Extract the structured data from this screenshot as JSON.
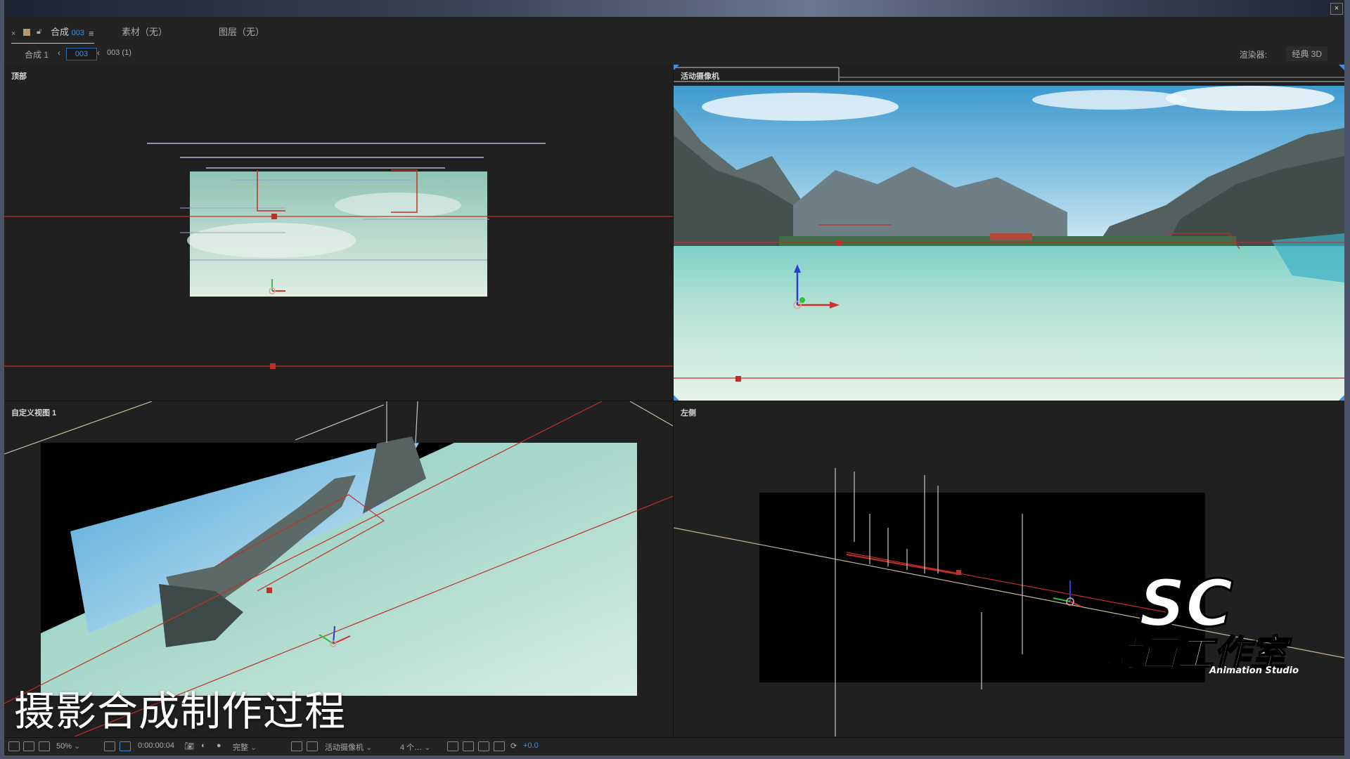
{
  "window": {
    "close_label": "×"
  },
  "tabs": {
    "close": "×",
    "comp_label": "合成",
    "comp_number": "003",
    "menu": "≡",
    "footage": "素材（无）",
    "layer": "图层（无）"
  },
  "breadcrumb": {
    "item1": "合成 1",
    "arrow_left": "‹",
    "current": "003",
    "arrow_right": "‹",
    "item2": "003 (1)"
  },
  "renderer": {
    "label": "渲染器:",
    "value": "经典 3D"
  },
  "viewports": {
    "top": "顶部",
    "active_camera": "活动摄像机",
    "custom_view": "自定义视图 1",
    "left": "左侧"
  },
  "toolbar": {
    "zoom": "50%",
    "timecode": "0:00:00:04",
    "resolution": "完整",
    "view": "活动摄像机",
    "view_count": "4 个…",
    "exposure": "+0.0"
  },
  "caption": "摄影合成制作过程",
  "watermark": {
    "logo_text": "SC",
    "subtitle": "动画工作室",
    "english": "Animation Studio"
  },
  "colors": {
    "accent_blue": "#3f8fe6",
    "guide_red": "#c0302a",
    "panel_bg": "#232323"
  }
}
